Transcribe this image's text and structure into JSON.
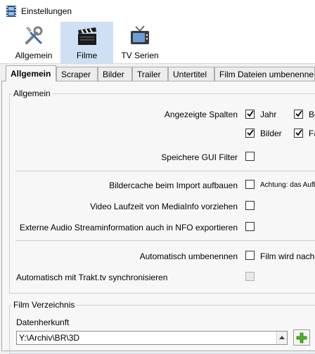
{
  "window": {
    "title": "Einstellungen"
  },
  "toolbar": {
    "items": [
      {
        "label": "Allgemein",
        "icon": "wrench-screwdriver-icon",
        "selected": false
      },
      {
        "label": "Filme",
        "icon": "clapperboard-icon",
        "selected": true
      },
      {
        "label": "TV Serien",
        "icon": "tv-icon",
        "selected": false
      }
    ]
  },
  "tabs": [
    {
      "label": "Allgemein",
      "active": true
    },
    {
      "label": "Scraper",
      "active": false
    },
    {
      "label": "Bilder",
      "active": false
    },
    {
      "label": "Trailer",
      "active": false
    },
    {
      "label": "Untertitel",
      "active": false
    },
    {
      "label": "Film Dateien umbenennen",
      "active": false
    }
  ],
  "general": {
    "legend": "Allgemein",
    "columns_label": "Angezeigte Spalten",
    "columns": [
      {
        "label": "Jahr",
        "checked": true
      },
      {
        "label": "Bewertung",
        "checked": true
      },
      {
        "label": "Bilder",
        "checked": true
      },
      {
        "label": "Fanart",
        "checked": true
      }
    ],
    "gui_filter_label": "Speichere GUI Filter",
    "gui_filter_checked": false,
    "image_cache_label": "Bildercache beim Import aufbauen",
    "image_cache_checked": false,
    "image_cache_hint": "Achtung: das Aufbauen",
    "runtime_label": "Video Laufzeit von MediaInfo vorziehen",
    "runtime_checked": false,
    "audio_label": "Externe Audio Streaminformation auch in NFO exportieren",
    "audio_checked": false,
    "rename_label": "Automatisch umbenennen",
    "rename_checked": false,
    "rename_hint": "Film wird nach",
    "trakt_label": "Automatisch mit Trakt.tv synchronisieren",
    "trakt_checked": false,
    "trakt_disabled": true
  },
  "film_dir": {
    "legend": "Film Verzeichnis",
    "source_label": "Datenherkunft",
    "source_value": "Y:\\Archiv\\BR\\3D"
  },
  "colors": {
    "selected_toolbar": "#cfe0f4",
    "add_icon": "#4caf28"
  }
}
